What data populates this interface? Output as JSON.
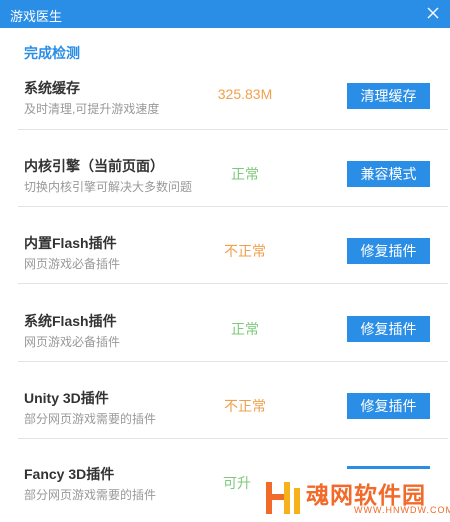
{
  "window": {
    "title": "游戏医生"
  },
  "section": {
    "title": "完成检测"
  },
  "rows": [
    {
      "name": "系统缓存",
      "desc": "及时清理,可提升游戏速度",
      "status": "325.83M",
      "button": "清理缓存"
    },
    {
      "name": "内核引擎（当前页面）",
      "desc": "切换内核引擎可解决大多数问题",
      "status": "正常",
      "button": "兼容模式"
    },
    {
      "name": "内置Flash插件",
      "desc": "网页游戏必备插件",
      "status": "不正常",
      "button": "修复插件"
    },
    {
      "name": "系统Flash插件",
      "desc": "网页游戏必备插件",
      "status": "正常",
      "button": "修复插件"
    },
    {
      "name": "Unity 3D插件",
      "desc": "部分网页游戏需要的插件",
      "status": "不正常",
      "button": "修复插件"
    },
    {
      "name": "Fancy 3D插件",
      "desc": "部分网页游戏需要的插件",
      "status": "可升"
    }
  ],
  "watermark": {
    "text": "魂网软件园",
    "url": "WWW.HNWDW.COM"
  },
  "colors": {
    "accent": "#2a8ee6",
    "warning": "#f0a04b",
    "ok": "#7dc97a",
    "watermark": "#f26a2a"
  },
  "icons": {
    "close": "close-icon",
    "logo": "watermark-logo-icon"
  }
}
